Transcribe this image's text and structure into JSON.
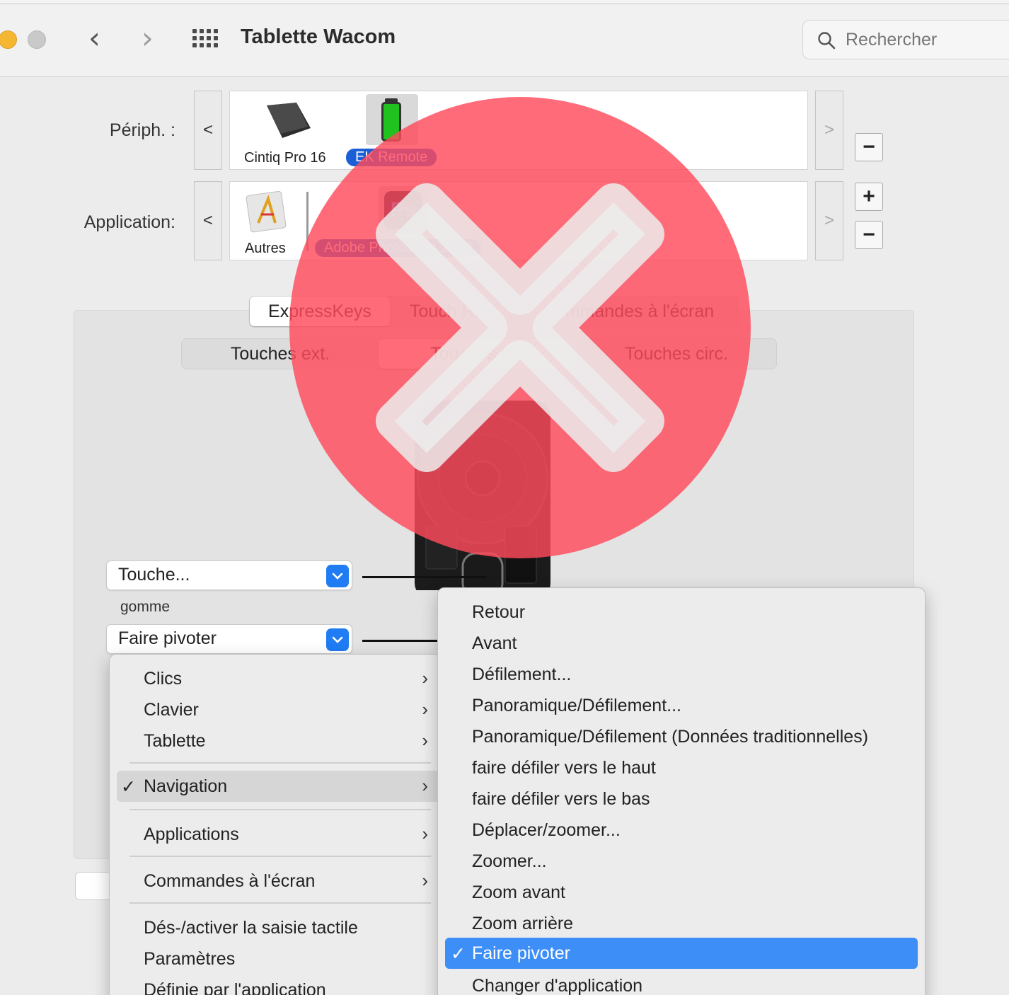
{
  "window": {
    "title": "Tablette Wacom",
    "search_placeholder": "Rechercher"
  },
  "devices": {
    "label": "Périph. :",
    "items": [
      {
        "label": "Cintiq Pro 16",
        "selected": false
      },
      {
        "label": "EK Remote",
        "selected": true
      }
    ],
    "prev": "<",
    "next": ">"
  },
  "applications": {
    "label": "Application:",
    "items": [
      {
        "label": "Autres",
        "selected": false
      },
      {
        "label": "Adobe Photoshop 2022",
        "selected": true
      }
    ],
    "prev": "<",
    "next": ">"
  },
  "buttons": {
    "minus": "−",
    "plus": "+"
  },
  "tabs": [
    "ExpressKeys",
    "Touch Ring",
    "Commandes à l'écran"
  ],
  "subtabs": [
    "Touches ext.",
    "Touches int.",
    "Touches circ."
  ],
  "mappings": [
    {
      "value": "Touche..."
    },
    {
      "value": "Faire pivoter"
    }
  ],
  "mapping_note": "gomme",
  "main_menu": [
    {
      "label": "Clics",
      "submenu": true
    },
    {
      "label": "Clavier",
      "submenu": true
    },
    {
      "label": "Tablette",
      "submenu": true
    },
    {
      "label": "Navigation",
      "submenu": true,
      "checked": true
    },
    {
      "label": "Applications",
      "submenu": true
    },
    {
      "label": "Commandes à l'écran",
      "submenu": true
    },
    {
      "label": "Dés-/activer la saisie tactile"
    },
    {
      "label": "Paramètres"
    },
    {
      "label": "Définie par l'application"
    }
  ],
  "navigation_submenu": [
    "Retour",
    "Avant",
    "Défilement...",
    "Panoramique/Défilement...",
    "Panoramique/Défilement (Données traditionnelles)",
    "faire défiler vers le haut",
    "faire défiler vers le bas",
    "Déplacer/zoomer...",
    "Zoomer...",
    "Zoom avant",
    "Zoom arrière",
    "Faire pivoter",
    "Changer d'application"
  ],
  "navigation_selected": "Faire pivoter",
  "check_glyph": "✓",
  "colors": {
    "accent": "#1f7cf3",
    "selection": "#3d8ef7",
    "overlay": "#ff4b5c"
  },
  "icons": [
    "search-icon",
    "grid-icon",
    "chevron-left-icon",
    "chevron-right-icon",
    "tablet-icon",
    "battery-remote-icon",
    "app-generic-icon",
    "photoshop-icon",
    "remote-device-image",
    "chevron-down-icon"
  ]
}
